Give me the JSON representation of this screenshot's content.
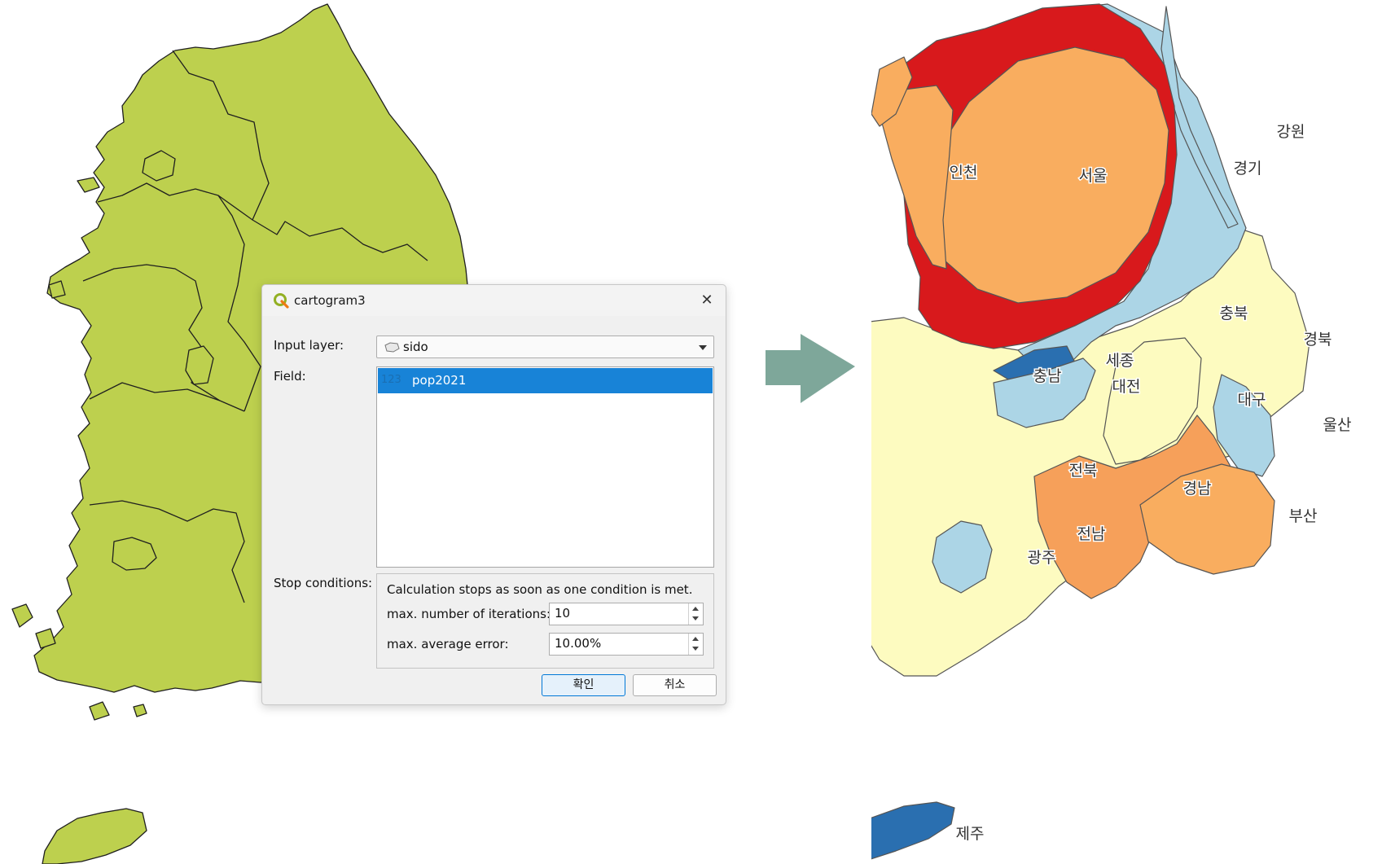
{
  "dialog": {
    "title": "cartogram3",
    "close_symbol": "✕",
    "input_layer_label": "Input layer:",
    "input_layer_value": "sido",
    "field_label": "Field:",
    "field_items": [
      {
        "type_badge": "123",
        "name": "pop2021"
      }
    ],
    "stop_conditions_label": "Stop conditions:",
    "stop_note": "Calculation stops as soon as one condition is met.",
    "max_iterations_label": "max. number of iterations:",
    "max_iterations_value": "10",
    "max_error_label": "max. average error:",
    "max_error_value": "10.00%",
    "ok_label": "확인",
    "cancel_label": "취소"
  },
  "cartogram_labels": {
    "seoul": "서울",
    "gyeonggi": "경기",
    "incheon": "인천",
    "gangwon": "강원",
    "chungbuk": "충북",
    "gyeongbuk": "경북",
    "chungnam": "충남",
    "sejong": "세종",
    "daejeon": "대전",
    "daegu": "대구",
    "ulsan": "울산",
    "jeonbuk": "전북",
    "gyeongnam": "경남",
    "busan": "부산",
    "jeonnam": "전남",
    "gwangju": "광주",
    "jeju": "제주"
  },
  "icons": {
    "qgis": "qgis-logo-icon",
    "layer": "polygon-layer-icon",
    "arrow": "right-arrow-icon"
  },
  "colors": {
    "left_map_fill": "#bdd04e",
    "arrow": "#7ea79a",
    "seoul": "#f9ad5f",
    "gyeonggi": "#d8191c",
    "light_blue": "#acd5e6",
    "dark_blue": "#2a6fb0",
    "cream": "#fdfbc0",
    "orange": "#f9ad5f"
  }
}
